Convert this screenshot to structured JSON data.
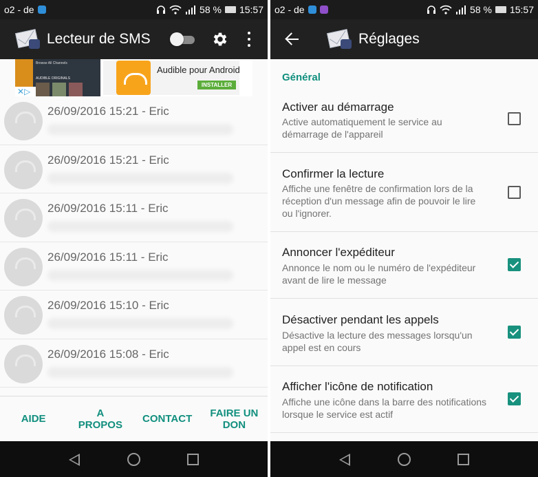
{
  "left": {
    "status": {
      "carrier": "o2 - de",
      "battery": "58 %",
      "time": "15:57"
    },
    "app_title": "Lecteur de SMS",
    "ad": {
      "thumb_line1": "Browse All Channels",
      "thumb_line2": "AUDIBLE ORIGINALS",
      "text": "Audible pour Android",
      "install": "INSTALLER",
      "badge": "✕▷"
    },
    "messages": [
      {
        "meta": "26/09/2016 15:21 - Eric"
      },
      {
        "meta": "26/09/2016 15:21 - Eric"
      },
      {
        "meta": "26/09/2016 15:11 - Eric"
      },
      {
        "meta": "26/09/2016 15:11 - Eric"
      },
      {
        "meta": "26/09/2016 15:10 - Eric"
      },
      {
        "meta": "26/09/2016 15:08 - Eric"
      }
    ],
    "bottom": {
      "aide": "AIDE",
      "apropos_1": "A",
      "apropos_2": "PROPOS",
      "contact": "CONTACT",
      "don_1": "FAIRE UN",
      "don_2": "DON"
    }
  },
  "right": {
    "status": {
      "carrier": "o2 - de",
      "battery": "58 %",
      "time": "15:57"
    },
    "title": "Réglages",
    "section": "Général",
    "prefs": [
      {
        "title": "Activer au démarrage",
        "summary": "Active automatiquement le service au démarrage de l'appareil",
        "checked": false
      },
      {
        "title": "Confirmer la lecture",
        "summary": "Affiche une fenêtre de confirmation lors de la réception d'un message afin de pouvoir le lire ou l'ignorer.",
        "checked": false
      },
      {
        "title": "Annoncer l'expéditeur",
        "summary": "Annonce le nom ou le numéro de l'expéditeur avant de lire le message",
        "checked": true
      },
      {
        "title": "Désactiver pendant les appels",
        "summary": "Désactive la lecture des messages lorsqu'un appel est en cours",
        "checked": true
      },
      {
        "title": "Afficher l'icône de notification",
        "summary": "Affiche une icône dans la barre des notifications lorsque le service est actif",
        "checked": true
      }
    ]
  },
  "colors": {
    "accent": "#118f7e",
    "appbar": "#212121",
    "statusbar": "#1b1b1b"
  },
  "icons": [
    "headphones-icon",
    "wifi-icon",
    "signal-icon",
    "gear-icon",
    "overflow-menu-icon",
    "back-arrow-icon",
    "nav-back-icon",
    "nav-home-icon",
    "nav-recents-icon"
  ]
}
